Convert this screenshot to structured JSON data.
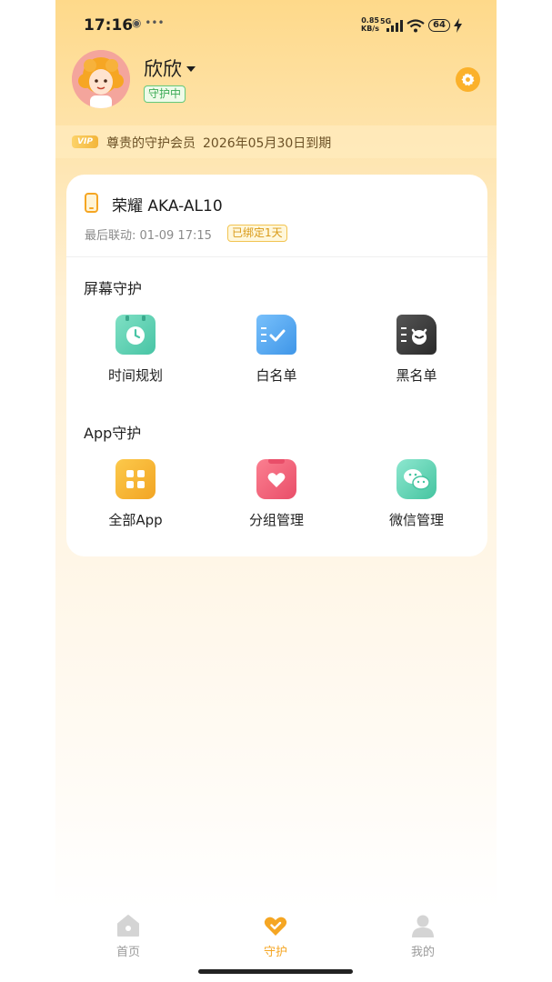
{
  "status_bar": {
    "time": "17:16",
    "net_speed_value": "0.85",
    "net_speed_unit": "KB/s",
    "network": "5G",
    "battery": "64"
  },
  "profile": {
    "name": "欣欣",
    "status_badge": "守护中"
  },
  "membership": {
    "tag": "VIP",
    "label": "尊贵的守护会员",
    "expiry": "2026年05月30日到期"
  },
  "device": {
    "name": "荣耀 AKA-AL10",
    "last_sync": "最后联动: 01-09 17:15",
    "bind_badge": "已绑定1天"
  },
  "screen_guard": {
    "title": "屏幕守护",
    "items": [
      {
        "label": "时间规划",
        "icon": "clock-calendar-icon",
        "color": "#5fd3b4"
      },
      {
        "label": "白名单",
        "icon": "whitelist-doc-icon",
        "color": "#4aa8f0"
      },
      {
        "label": "黑名单",
        "icon": "blacklist-doc-icon",
        "color": "#3a3a3a"
      }
    ]
  },
  "app_guard": {
    "title": "App守护",
    "items": [
      {
        "label": "全部App",
        "icon": "apps-grid-icon",
        "color": "#f7b733"
      },
      {
        "label": "分组管理",
        "icon": "heart-group-icon",
        "color": "#f0607a"
      },
      {
        "label": "微信管理",
        "icon": "wechat-icon",
        "color": "#5fd3b4"
      }
    ]
  },
  "tab_bar": {
    "items": [
      {
        "label": "首页",
        "icon": "home-icon",
        "active": false
      },
      {
        "label": "守护",
        "icon": "heart-check-icon",
        "active": true
      },
      {
        "label": "我的",
        "icon": "user-icon",
        "active": false
      }
    ]
  },
  "colors": {
    "accent": "#f5a623",
    "badge_green": "#3cab56",
    "header_gradient_top": "#fed98a"
  }
}
